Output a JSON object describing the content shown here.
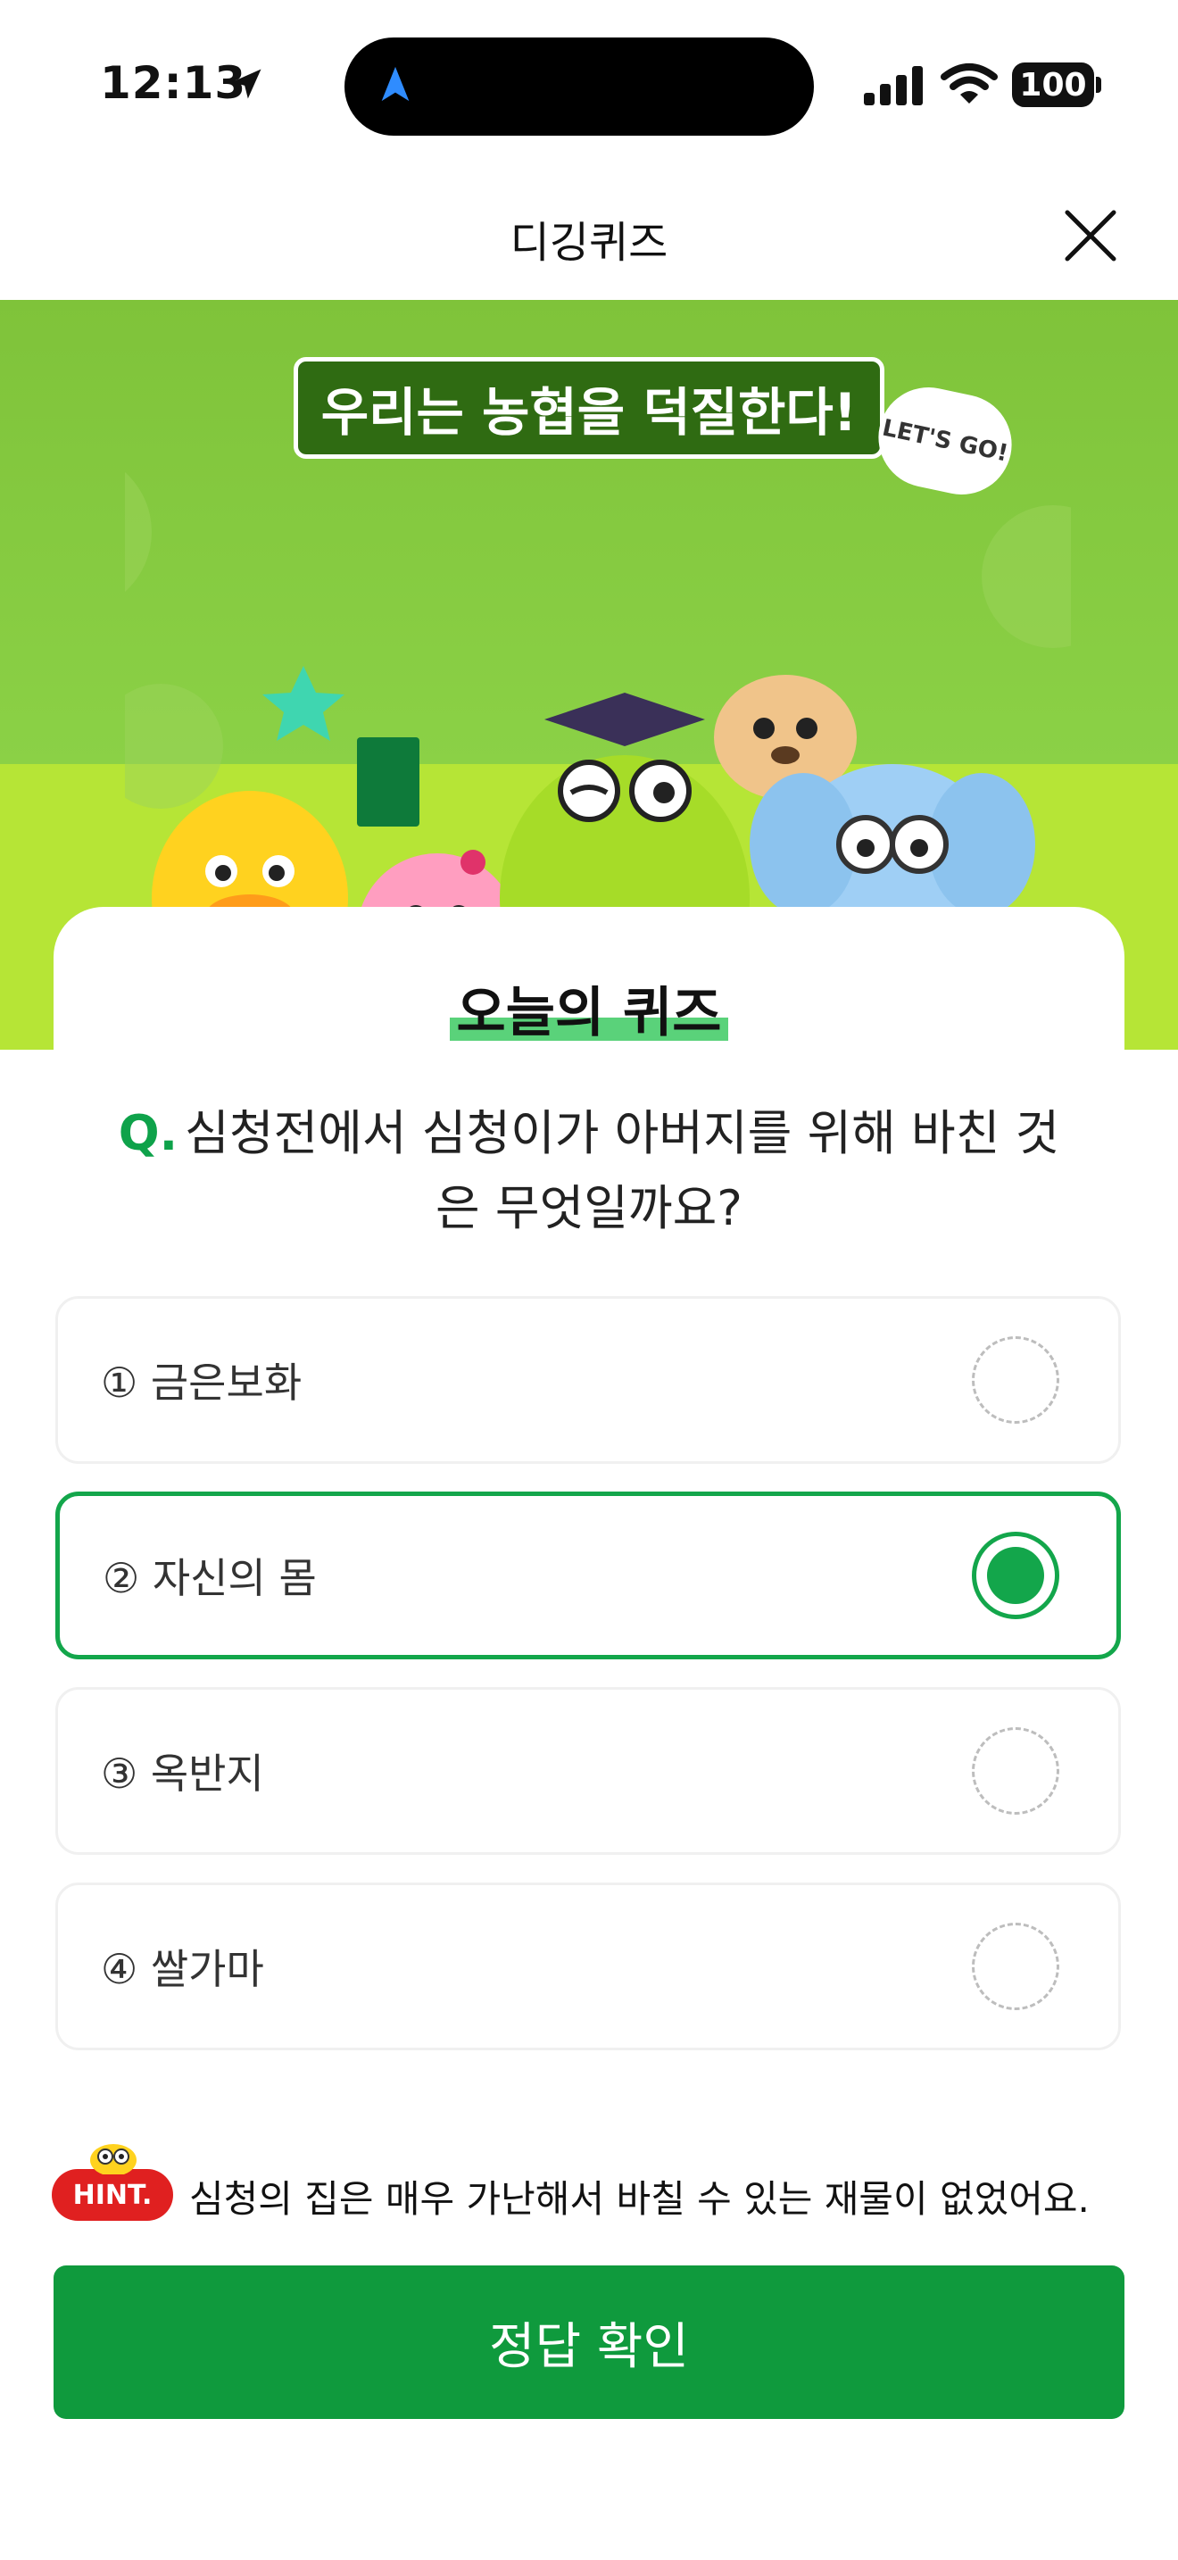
{
  "status_bar": {
    "time": "12:13",
    "battery": "100",
    "icons": [
      "location-arrow-icon",
      "signal-icon",
      "wifi-icon",
      "battery-icon"
    ]
  },
  "nav": {
    "title": "디깅퀴즈",
    "close_icon": "close-icon"
  },
  "banner": {
    "headline": "우리는 농협을 덕질한다!",
    "sticker": "LET'S GO!"
  },
  "quiz": {
    "label": "오늘의 퀴즈",
    "question_prefix": "Q.",
    "question": "심청전에서 심청이가 아버지를 위해 바친 것은 무엇일까요?",
    "options": [
      {
        "label": "① 금은보화",
        "selected": false
      },
      {
        "label": "② 자신의 몸",
        "selected": true
      },
      {
        "label": "③ 옥반지",
        "selected": false
      },
      {
        "label": "④ 쌀가마",
        "selected": false
      }
    ],
    "selected_index": 1
  },
  "hint": {
    "badge": "HINT.",
    "text": "심청의 집은 매우 가난해서 바칠 수 있는 재물이 없었어요."
  },
  "submit": {
    "label": "정답 확인"
  },
  "colors": {
    "accent": "#13a64b",
    "button": "#0f9a3d",
    "hint_badge": "#e02020",
    "banner_green": "#8bd146"
  }
}
